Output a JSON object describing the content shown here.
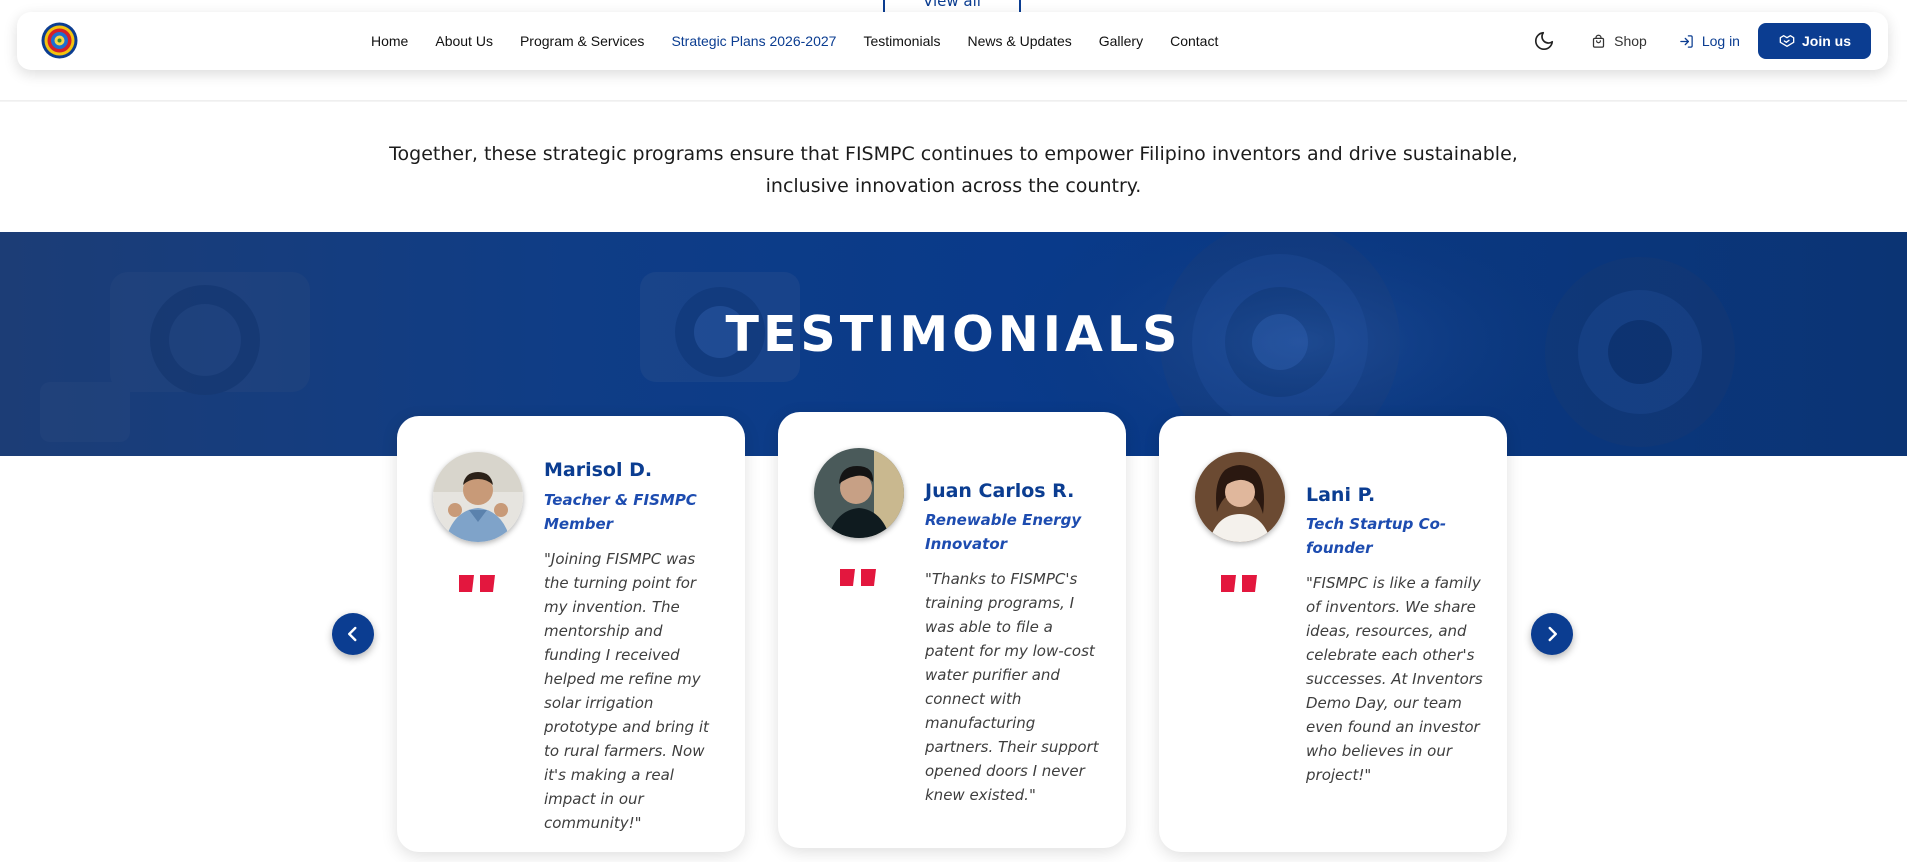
{
  "previous_section": {
    "button_label": "View all"
  },
  "nav": {
    "links": [
      {
        "label": "Home",
        "active": false
      },
      {
        "label": "About Us",
        "active": false
      },
      {
        "label": "Program & Services",
        "active": false
      },
      {
        "label": "Strategic Plans 2026-2027",
        "active": true
      },
      {
        "label": "Testimonials",
        "active": false
      },
      {
        "label": "News & Updates",
        "active": false
      },
      {
        "label": "Gallery",
        "active": false
      },
      {
        "label": "Contact",
        "active": false
      }
    ],
    "theme_toggle_icon": "moon-icon",
    "shop_label": "Shop",
    "login_label": "Log in",
    "join_label": "Join us"
  },
  "intro": {
    "text": "Together, these strategic programs ensure that FISMPC continues to empower Filipino inventors and drive sustainable, inclusive innovation across the country."
  },
  "banner": {
    "title": "TESTIMONIALS"
  },
  "testimonials": [
    {
      "name": "Marisol D.",
      "role": "Teacher & FISMPC Member",
      "text": "\"Joining FISMPC was the turning point for my invention. The mentorship and funding I received helped me refine my solar irrigation prototype and bring it to rural farmers. Now it's making a real impact in our community!\""
    },
    {
      "name": "Juan Carlos R.",
      "role": "Renewable Energy Innovator",
      "text": "\"Thanks to FISMPC's training programs, I was able to file a patent for my low-cost water purifier and connect with manufacturing partners. Their support opened doors I never knew existed.\""
    },
    {
      "name": "Lani P.",
      "role": "Tech Startup Co-founder",
      "text": "\"FISMPC is like a family of inventors. We share ideas, resources, and celebrate each other's successes. At Inventors Demo Day, our team even found an investor who believes in our project!\""
    }
  ],
  "carousel": {
    "prev_icon": "chevron-left-icon",
    "next_icon": "chevron-right-icon"
  },
  "colors": {
    "brand": "#0b3d91",
    "accent_quote": "#e3173e",
    "role": "#1d4cb0"
  }
}
